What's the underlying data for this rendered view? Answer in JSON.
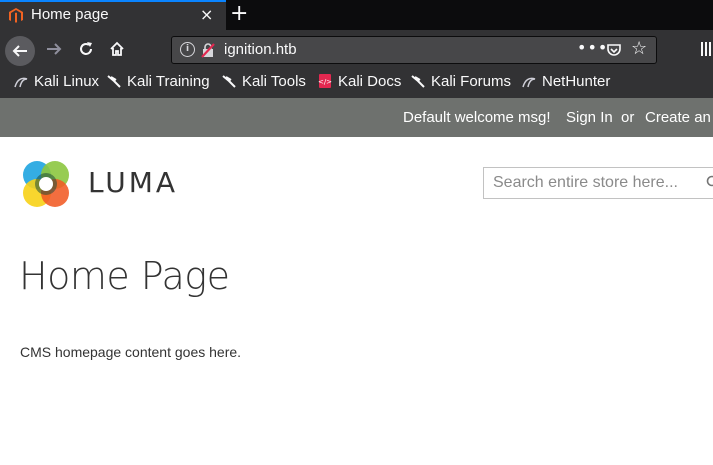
{
  "browser": {
    "tab": {
      "title": "Home page",
      "close_glyph": "×"
    },
    "new_tab_glyph": "+",
    "url": "ignition.htb",
    "url_menu_glyph": "•••",
    "bookmarks": [
      {
        "label": "Kali Linux",
        "icon": "kali-dragon-icon"
      },
      {
        "label": "Kali Training",
        "icon": "kali-dragon-icon"
      },
      {
        "label": "Kali Tools",
        "icon": "kali-dragon-icon"
      },
      {
        "label": "Kali Docs",
        "icon": "kali-docs-icon"
      },
      {
        "label": "Kali Forums",
        "icon": "kali-dragon-icon"
      },
      {
        "label": "NetHunter",
        "icon": "kali-dragon-icon"
      }
    ]
  },
  "header_panel": {
    "welcome": "Default welcome msg!",
    "sign_in": "Sign In",
    "or": "or",
    "create_account": "Create an"
  },
  "logo": {
    "text": "LUMA"
  },
  "search": {
    "placeholder": "Search entire store here..."
  },
  "main": {
    "title": "Home Page",
    "content": "CMS homepage content goes here."
  },
  "colors": {
    "panel_bg": "#6e716e",
    "browser_bg": "#323234",
    "text": "#333333"
  }
}
